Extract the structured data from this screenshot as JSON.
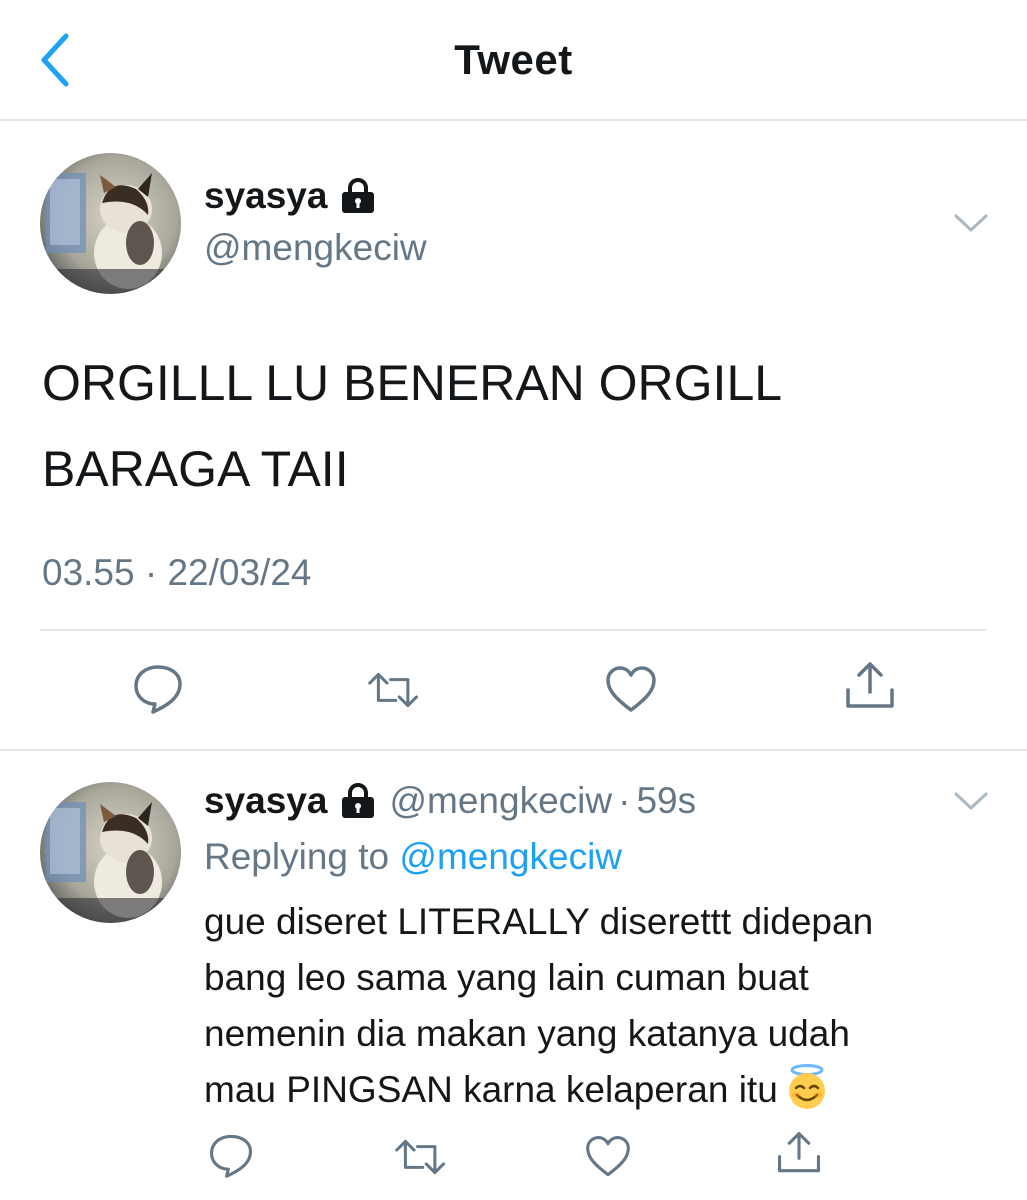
{
  "header": {
    "title": "Tweet"
  },
  "main_tweet": {
    "display_name": "syasya",
    "handle": "@mengkeciw",
    "text_line1": "ORGILLL LU BENERAN ORGILL",
    "text_line2": "BARAGA TAII",
    "timestamp": "03.55 · 22/03/24"
  },
  "reply": {
    "display_name": "syasya",
    "handle": "@mengkeciw",
    "separator": "·",
    "time": "59s",
    "replying_prefix": "Replying to",
    "replying_to": "@mengkeciw",
    "text_line1": "gue diseret LITERALLY diserettt didepan",
    "text_line2": "bang leo sama yang lain cuman buat",
    "text_line3": "nemenin dia makan yang katanya udah",
    "text_line4": "mau PINGSAN karna kelaperan itu"
  },
  "icons": {
    "back": "chevron-left-icon",
    "lock": "lock-icon",
    "more": "chevron-down-icon",
    "reply": "reply-bubble-icon",
    "retweet": "retweet-icon",
    "like": "heart-icon",
    "share": "share-icon",
    "emoji": "smiling-face-with-halo-emoji"
  },
  "colors": {
    "accent": "#1da1f2",
    "secondary_text": "#657786",
    "divider": "#e1e8ed",
    "icon": "#657786"
  }
}
